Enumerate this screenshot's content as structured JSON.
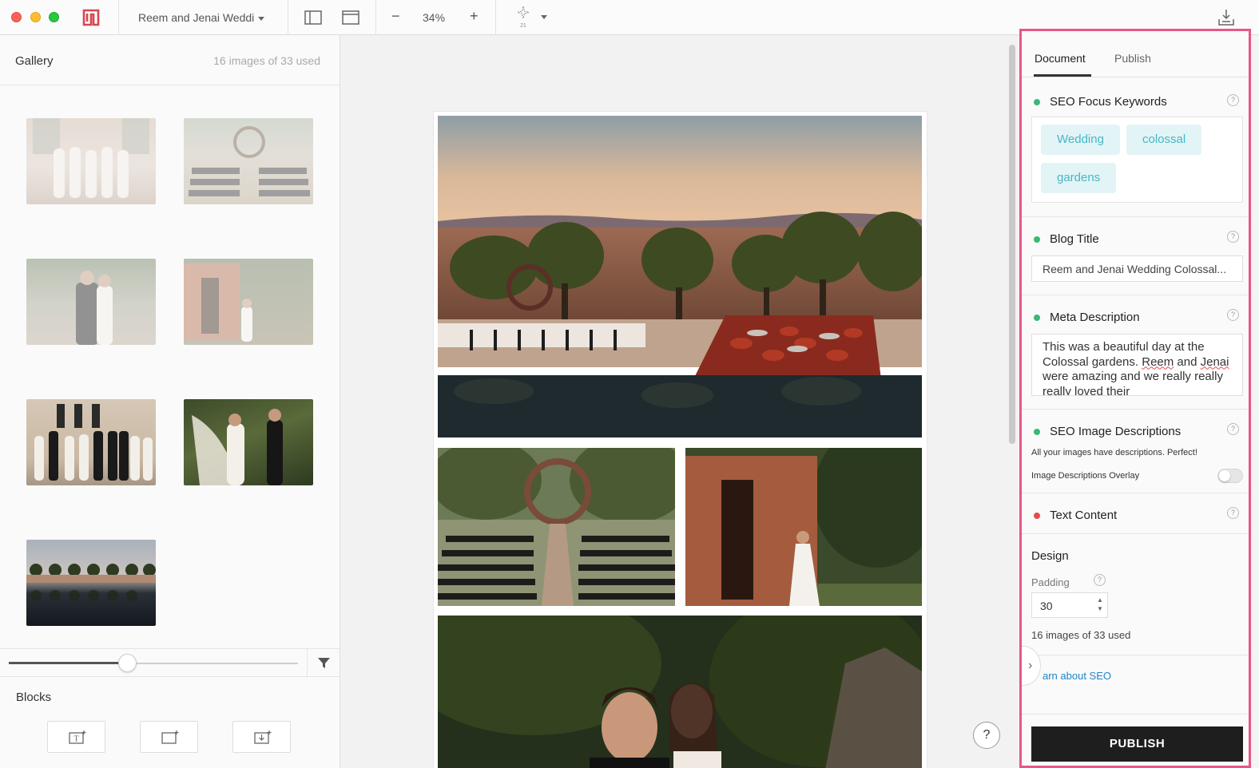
{
  "toolbar": {
    "document_title": "Reem and Jenai Weddi",
    "zoom": "34%",
    "zoom_out": "−",
    "zoom_in": "+",
    "sparkle_count": "21"
  },
  "gallery": {
    "title": "Gallery",
    "count": "16 images of 33 used"
  },
  "blocks": {
    "title": "Blocks"
  },
  "canvas": {
    "help": "?"
  },
  "sidebar": {
    "tabs": [
      "Document",
      "Publish"
    ],
    "seo_keywords": {
      "label": "SEO Focus Keywords",
      "keywords": [
        "Wedding",
        "colossal",
        "gardens"
      ]
    },
    "blog_title": {
      "label": "Blog Title",
      "value": "Reem and Jenai Wedding Colossal..."
    },
    "meta_description": {
      "label": "Meta Description",
      "value_start": "This was a beautiful day at the Colossal gardens. ",
      "value_reem": "Reem",
      "value_mid": " and ",
      "value_jenai": "Jenai",
      "value_end": " were amazing and we really really really loved their"
    },
    "image_descriptions": {
      "label": "SEO Image Descriptions",
      "status": "All your images have descriptions. Perfect!",
      "overlay_label": "Image Descriptions Overlay"
    },
    "text_content": {
      "label": "Text Content"
    },
    "design": {
      "title": "Design",
      "padding_label": "Padding",
      "padding_value": "30",
      "used": "16 images of 33 used"
    },
    "seo_link": "arn about SEO",
    "publish": "PUBLISH",
    "help": "?"
  },
  "colors": {
    "accent_pink": "#e8558a",
    "status_green": "#39b877",
    "status_red": "#e64a4a",
    "keyword_text": "#46b7c5",
    "link": "#1f84c9",
    "publish_bg": "#1e1e1e"
  }
}
